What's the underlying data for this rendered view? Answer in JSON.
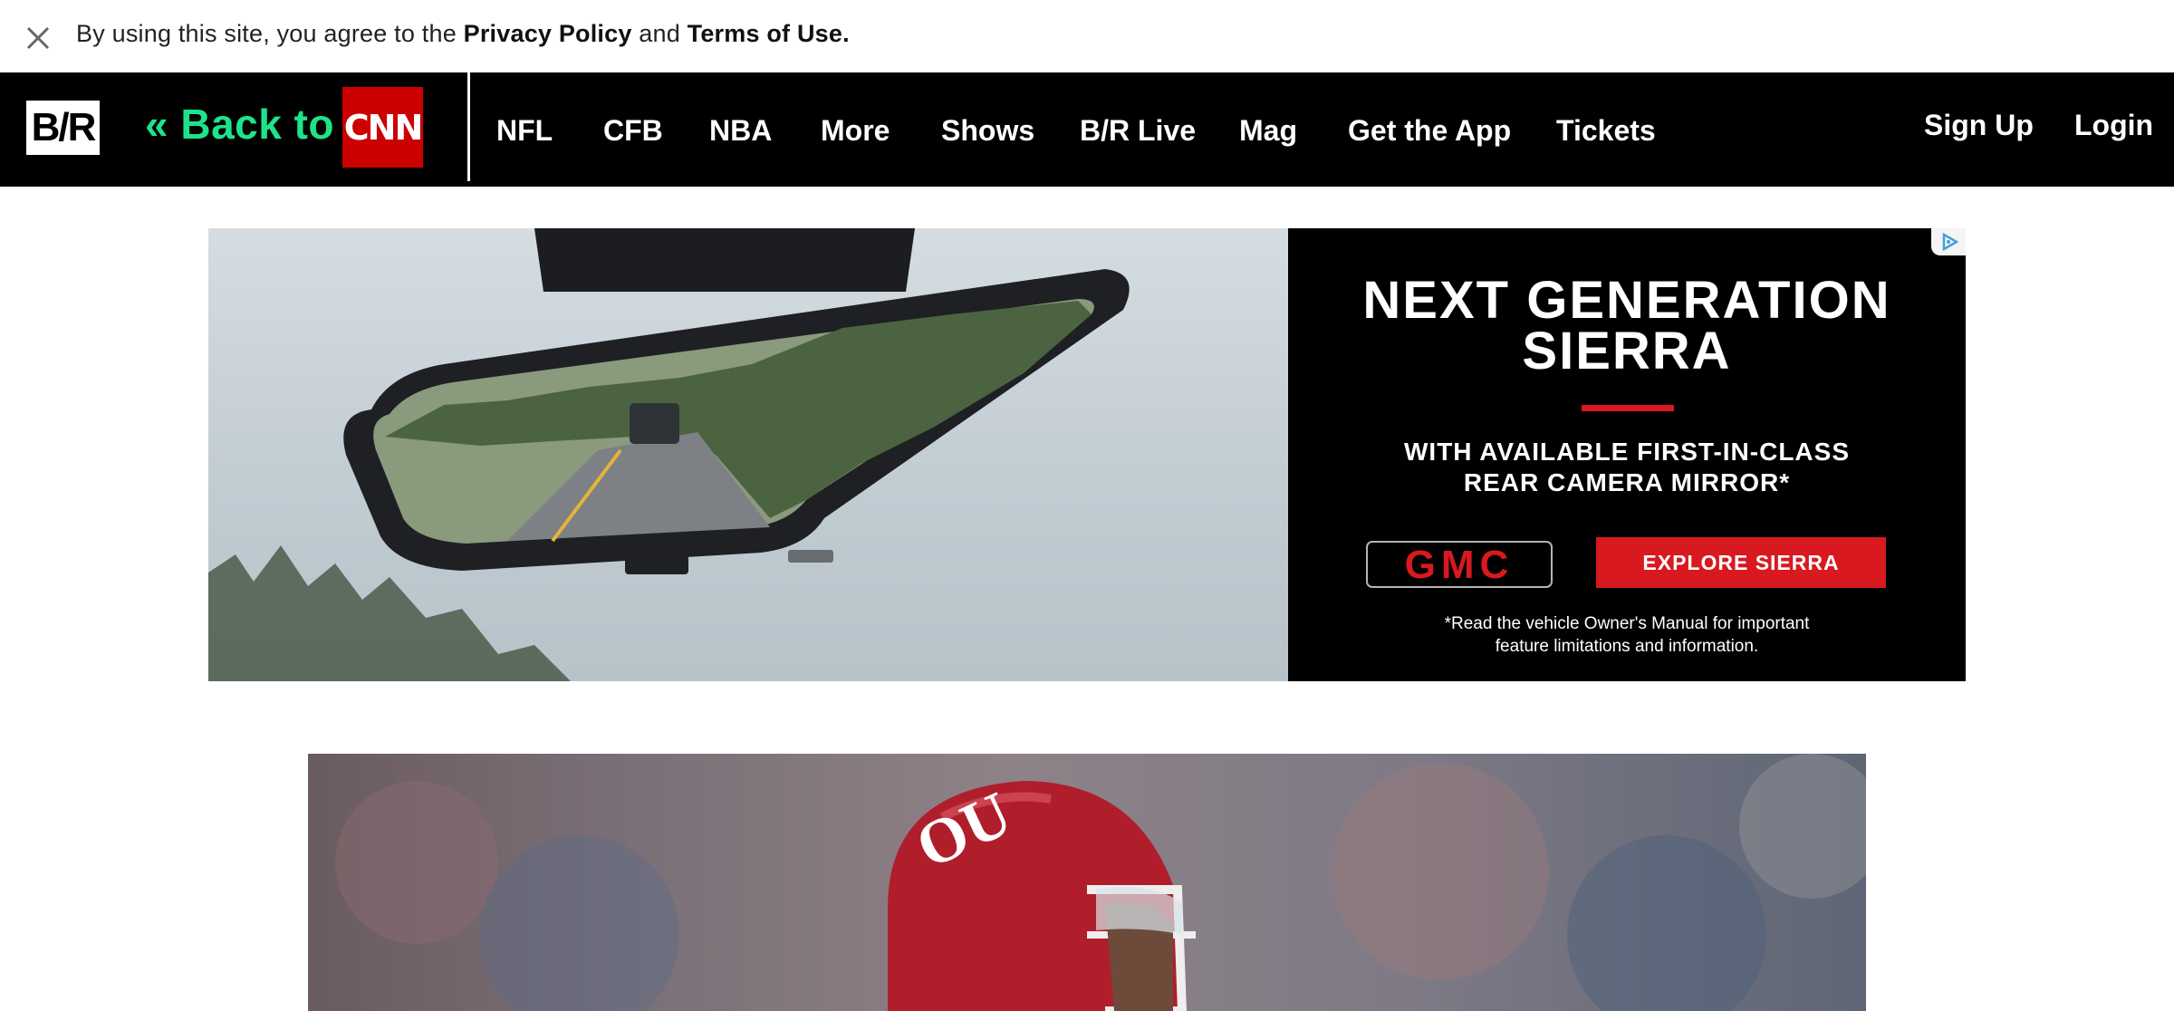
{
  "consent": {
    "prefix": "By using this site, you agree to the ",
    "privacy_link": "Privacy Policy",
    "and": " and ",
    "terms_link": "Terms of Use."
  },
  "nav": {
    "logo": "B/R",
    "back_label": "« Back to",
    "cnn_logo": "CNN",
    "items": [
      "NFL",
      "CFB",
      "NBA",
      "More",
      "Shows",
      "B/R Live",
      "Mag",
      "Get the App",
      "Tickets"
    ],
    "sign_up": "Sign Up",
    "login": "Login"
  },
  "ad": {
    "headline_1": "NEXT GENERATION",
    "headline_2": "SIERRA",
    "sub_1": "WITH AVAILABLE FIRST-IN-CLASS",
    "sub_2": "REAR CAMERA MIRROR*",
    "brand": "GMC",
    "cta": "EXPLORE SIERRA",
    "disclaimer_1": "*Read the vehicle Owner's Manual for important",
    "disclaimer_2": "feature limitations and information."
  },
  "colors": {
    "nav_bg": "#000000",
    "back_link": "#1ee38a",
    "cnn_red": "#cc0000",
    "gmc_red": "#d81920"
  }
}
